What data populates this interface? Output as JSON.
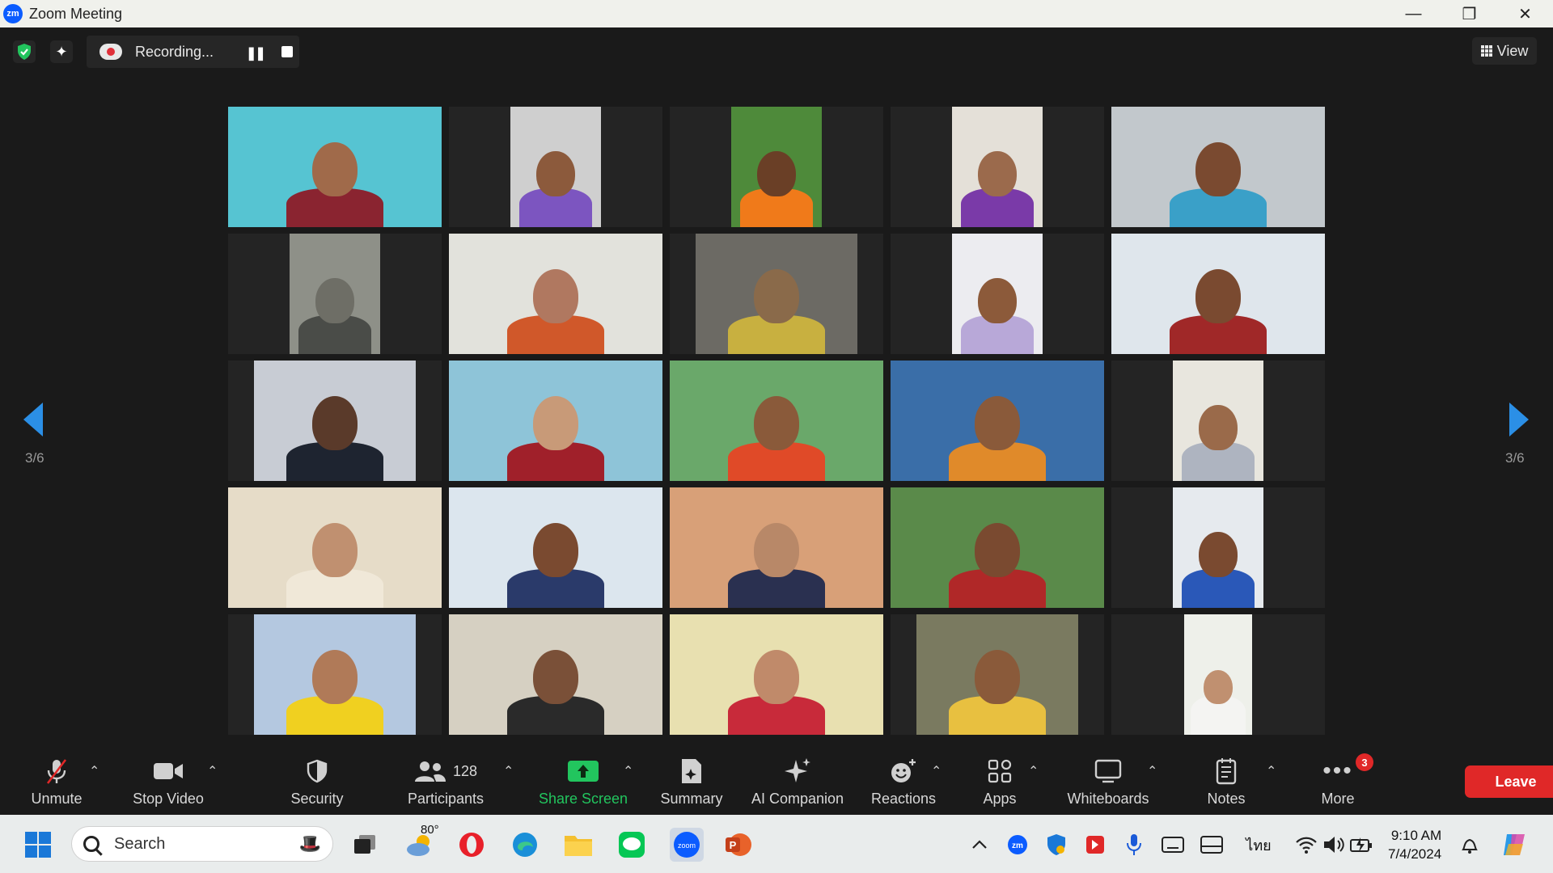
{
  "window": {
    "title": "Zoom Meeting",
    "logo_text": "zm",
    "minimize": "—",
    "restore": "❐",
    "close": "✕"
  },
  "top_bar": {
    "recording_label": "Recording...",
    "view_label": "View"
  },
  "gallery": {
    "page_indicator_left": "3/6",
    "page_indicator_right": "3/6",
    "tiles": [
      {
        "bg": "#3fa7b5",
        "vw": 264,
        "wall": "#56c4d2",
        "skin": "#a06a4a",
        "shirt": "#8a2430"
      },
      {
        "bg": "#242424",
        "vw": 112,
        "wall": "#cfcfcf",
        "skin": "#8c5a3c",
        "shirt": "#7c55c0"
      },
      {
        "bg": "#242424",
        "vw": 112,
        "wall": "#4e8a3a",
        "skin": "#6a3f26",
        "shirt": "#f07a1a"
      },
      {
        "bg": "#242424",
        "vw": 112,
        "wall": "#e4e0d8",
        "skin": "#9b6a4c",
        "shirt": "#7a3aa8"
      },
      {
        "bg": "#242424",
        "vw": 264,
        "wall": "#c2c8cc",
        "skin": "#7a4a30",
        "shirt": "#3aa0c8"
      },
      {
        "bg": "#242424",
        "vw": 112,
        "wall": "#8e9088",
        "skin": "#6e6e66",
        "shirt": "#4a4c48"
      },
      {
        "bg": "#242424",
        "vw": 264,
        "wall": "#e2e2dc",
        "skin": "#b07860",
        "shirt": "#d0582a"
      },
      {
        "bg": "#242424",
        "vw": 200,
        "wall": "#6c6a64",
        "skin": "#8a6a4a",
        "shirt": "#c8b040"
      },
      {
        "bg": "#242424",
        "vw": 112,
        "wall": "#ececf0",
        "skin": "#8c5a3a",
        "shirt": "#b8a8d8"
      },
      {
        "bg": "#242424",
        "vw": 264,
        "wall": "#dfe6ec",
        "skin": "#7a4a30",
        "shirt": "#a02828"
      },
      {
        "bg": "#242424",
        "vw": 200,
        "wall": "#c8ccd4",
        "skin": "#5a3a2a",
        "shirt": "#1e2430"
      },
      {
        "bg": "#242424",
        "vw": 264,
        "wall": "#8ec4d8",
        "skin": "#c89a78",
        "shirt": "#a0202a"
      },
      {
        "bg": "#242424",
        "vw": 264,
        "wall": "#6aa86a",
        "skin": "#8a5a3a",
        "shirt": "#e04a28"
      },
      {
        "bg": "#242424",
        "vw": 264,
        "wall": "#3a6ea8",
        "skin": "#8a5a3a",
        "shirt": "#e08a2a"
      },
      {
        "bg": "#242424",
        "vw": 112,
        "wall": "#e8e6de",
        "skin": "#9a6a4a",
        "shirt": "#aeb4c0"
      },
      {
        "bg": "#242424",
        "vw": 264,
        "wall": "#e6dcc8",
        "skin": "#c09070",
        "shirt": "#f0e8d8"
      },
      {
        "bg": "#242424",
        "vw": 264,
        "wall": "#dce6ee",
        "skin": "#7a4a30",
        "shirt": "#2a3a6a"
      },
      {
        "bg": "#242424",
        "vw": 264,
        "wall": "#d8a078",
        "skin": "#b88868",
        "shirt": "#2a3050"
      },
      {
        "bg": "#242424",
        "vw": 264,
        "wall": "#5a8a4a",
        "skin": "#7a4a30",
        "shirt": "#b02828"
      },
      {
        "bg": "#242424",
        "vw": 112,
        "wall": "#e6eaee",
        "skin": "#7a4a30",
        "shirt": "#2a58b8"
      },
      {
        "bg": "#242424",
        "vw": 200,
        "wall": "#b4c8e0",
        "skin": "#b07a58",
        "shirt": "#f0d020"
      },
      {
        "bg": "#242424",
        "vw": 264,
        "wall": "#d6d0c2",
        "skin": "#7a5038",
        "shirt": "#2a2a2a"
      },
      {
        "bg": "#242424",
        "vw": 264,
        "wall": "#e8e0b0",
        "skin": "#c08a6a",
        "shirt": "#c82a3a"
      },
      {
        "bg": "#242424",
        "vw": 200,
        "wall": "#7a7a60",
        "skin": "#8a5a3a",
        "shirt": "#e8c040"
      },
      {
        "bg": "#242424",
        "vw": 84,
        "wall": "#eef0ea",
        "skin": "#c09070",
        "shirt": "#f4f4f2"
      }
    ]
  },
  "toolbar": {
    "unmute": "Unmute",
    "stop_video": "Stop Video",
    "security": "Security",
    "participants": "Participants",
    "participants_count": "128",
    "share_screen": "Share Screen",
    "summary": "Summary",
    "ai_companion": "AI Companion",
    "reactions": "Reactions",
    "apps": "Apps",
    "whiteboards": "Whiteboards",
    "notes": "Notes",
    "more": "More",
    "more_badge": "3",
    "leave": "Leave"
  },
  "taskbar": {
    "search_placeholder": "Search",
    "weather": "80°",
    "time": "9:10 AM",
    "date": "7/4/2024",
    "language": "ไทย"
  },
  "colors": {
    "accent_blue": "#2b8fe6",
    "share_green": "#22c55e",
    "leave_red": "#e02828"
  }
}
